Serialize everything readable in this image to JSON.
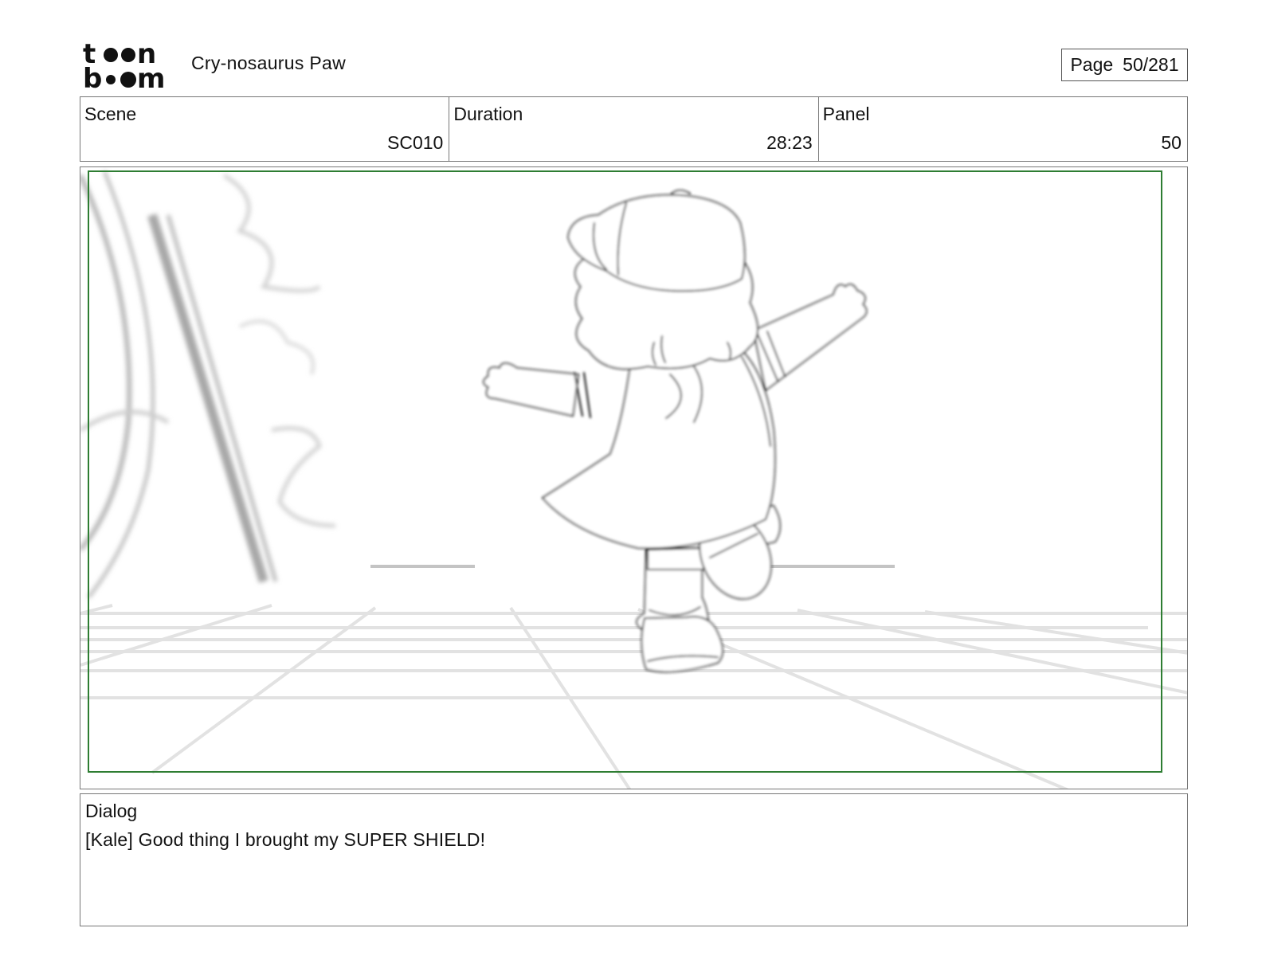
{
  "header": {
    "logo_top": "t●●n",
    "logo_bottom": "b●●m",
    "project_title": "Cry-nosaurus Paw",
    "page_label": "Page",
    "page_value": "50/281"
  },
  "info": {
    "scene_label": "Scene",
    "scene_value": "SC010",
    "duration_label": "Duration",
    "duration_value": "28:23",
    "panel_label": "Panel",
    "panel_value": "50"
  },
  "dialog": {
    "label": "Dialog",
    "text": "[Kale] Good thing I brought my SUPER SHIELD!"
  },
  "colors": {
    "safe_frame": "#2e7d32",
    "border": "#777777",
    "background_sketch": "#c8c8c8"
  }
}
